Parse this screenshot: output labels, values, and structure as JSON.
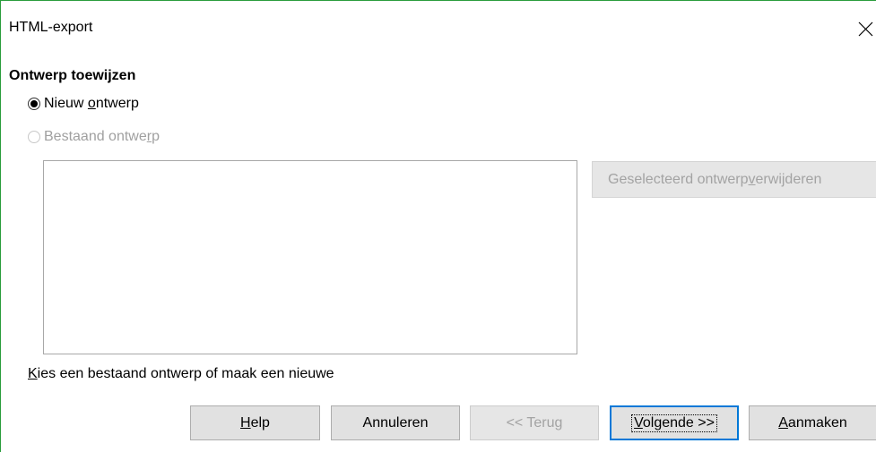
{
  "window": {
    "title": "HTML-export",
    "close_icon": "close-icon"
  },
  "section": {
    "heading": "Ontwerp toewijzen"
  },
  "options": {
    "new_design": {
      "pre": "Nieuw ",
      "accel": "o",
      "post": "ntwerp",
      "checked": true
    },
    "existing_design": {
      "pre": "Bestaand ontwe",
      "accel": "r",
      "post": "p",
      "enabled": false
    }
  },
  "design_list": {
    "items": []
  },
  "remove_button": {
    "pre": "Geselecteerd ontwerp ",
    "accel": "v",
    "post": "erwijderen",
    "enabled": false
  },
  "hint": {
    "accel": "K",
    "post": "ies een bestaand ontwerp of maak een nieuwe"
  },
  "buttons": {
    "help": {
      "accel": "H",
      "post": "elp"
    },
    "cancel": {
      "label": "Annuleren"
    },
    "back": {
      "label": "<< Terug",
      "enabled": false
    },
    "next": {
      "accel": "V",
      "post": "olgende >>",
      "default": true
    },
    "create": {
      "accel": "A",
      "post": "anmaken"
    }
  },
  "colors": {
    "window_border": "#2a9d3c",
    "default_button_border": "#0078d7",
    "disabled_text": "#a3a3a3"
  }
}
